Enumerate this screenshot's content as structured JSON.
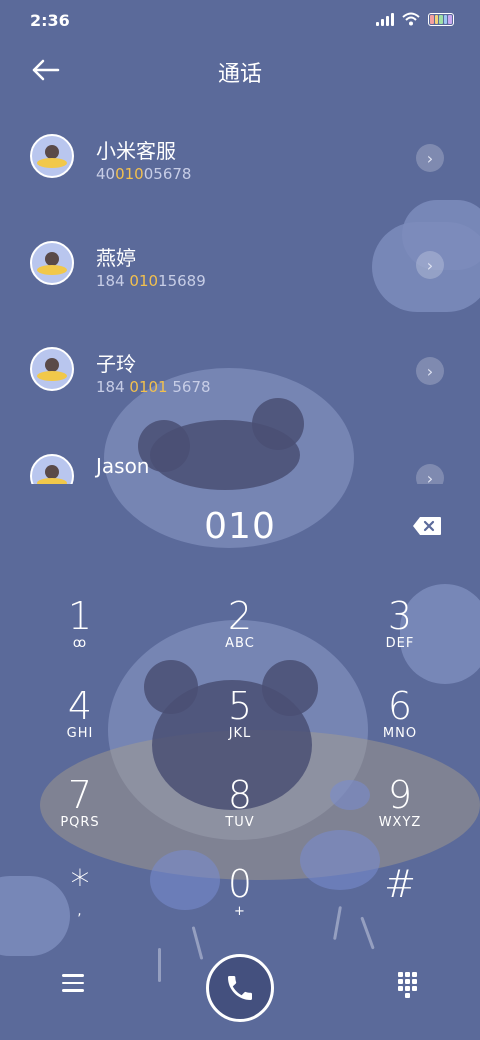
{
  "status_bar": {
    "time": "2:36"
  },
  "header": {
    "title": "通话",
    "back_icon": "back-arrow-icon"
  },
  "contacts": [
    {
      "name": "小米客服",
      "number_parts": [
        "40",
        "010",
        "05678"
      ]
    },
    {
      "name": "燕婷",
      "number_parts": [
        "184 ",
        "010",
        "15689"
      ]
    },
    {
      "name": "子玲",
      "number_parts": [
        "184 ",
        "0101",
        " 5678"
      ]
    },
    {
      "name": "Jason",
      "number_parts": [
        "",
        "",
        ""
      ]
    }
  ],
  "dialer": {
    "input": "010",
    "keys": [
      {
        "digit": "1",
        "letters": "ꝏ"
      },
      {
        "digit": "2",
        "letters": "ABC"
      },
      {
        "digit": "3",
        "letters": "DEF"
      },
      {
        "digit": "4",
        "letters": "GHI"
      },
      {
        "digit": "5",
        "letters": "JKL"
      },
      {
        "digit": "6",
        "letters": "MNO"
      },
      {
        "digit": "7",
        "letters": "PQRS"
      },
      {
        "digit": "8",
        "letters": "TUV"
      },
      {
        "digit": "9",
        "letters": "WXYZ"
      },
      {
        "digit": "*",
        "letters": ","
      },
      {
        "digit": "0",
        "letters": "+"
      },
      {
        "digit": "#",
        "letters": ""
      }
    ]
  },
  "colors": {
    "background": "#5b6a9a",
    "highlight": "#f2c04e"
  }
}
